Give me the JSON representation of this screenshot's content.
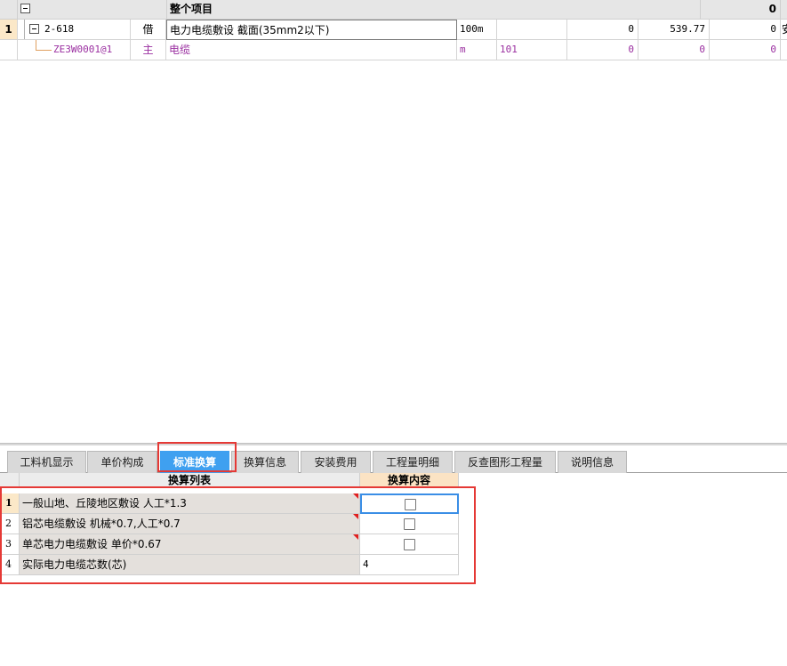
{
  "top_grid": {
    "header": {
      "title": "整个项目",
      "right_value": "0"
    },
    "rows": [
      {
        "row_no": "1",
        "code": "2-618",
        "type": "借",
        "name": "电力电缆敷设 截面(35mm2以下)",
        "unit": "100m",
        "qty": "",
        "v1": "0",
        "v2": "539.77",
        "v3": "0",
        "tail": "安"
      },
      {
        "row_no": "",
        "code": "ZE3W0001@1",
        "type": "主",
        "name": "电缆",
        "unit": "m",
        "qty": "101",
        "v1": "0",
        "v2": "0",
        "v3": "0",
        "tail": ""
      }
    ]
  },
  "tabs": [
    {
      "label": "工料机显示",
      "active": false
    },
    {
      "label": "单价构成",
      "active": false
    },
    {
      "label": "标准换算",
      "active": true
    },
    {
      "label": "换算信息",
      "active": false
    },
    {
      "label": "安装费用",
      "active": false
    },
    {
      "label": "工程量明细",
      "active": false
    },
    {
      "label": "反查图形工程量",
      "active": false
    },
    {
      "label": "说明信息",
      "active": false
    }
  ],
  "conversion": {
    "headers": {
      "list": "换算列表",
      "content": "换算内容"
    },
    "rows": [
      {
        "no": "1",
        "label": "一般山地、丘陵地区敷设 人工*1.3",
        "value": "",
        "checkbox": true,
        "checked": false
      },
      {
        "no": "2",
        "label": "铝芯电缆敷设 机械*0.7,人工*0.7",
        "value": "",
        "checkbox": true,
        "checked": false
      },
      {
        "no": "3",
        "label": "单芯电力电缆敷设 单价*0.67",
        "value": "",
        "checkbox": true,
        "checked": false
      },
      {
        "no": "4",
        "label": "实际电力电缆芯数(芯)",
        "value": "4",
        "checkbox": false,
        "checked": false
      }
    ]
  },
  "colors": {
    "active_tab": "#3fa0f0",
    "highlight": "#e53935",
    "purple_text": "#9a2ea0"
  }
}
